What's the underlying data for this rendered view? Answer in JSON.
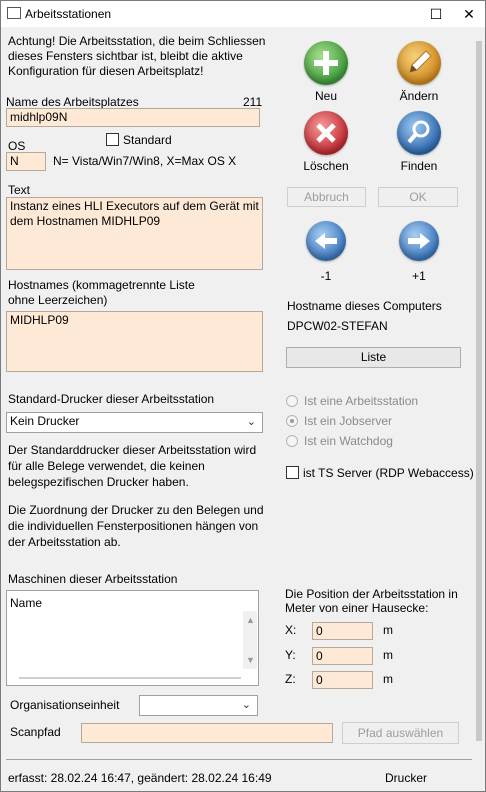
{
  "window": {
    "title": "Arbeitsstationen",
    "minimize_glyph": "—",
    "maximize_glyph": "☐",
    "close_glyph": "✕"
  },
  "warning": "Achtung! Die Arbeitsstation, die beim Schliessen dieses Fensters sichtbar ist, bleibt die aktive Konfiguration für diesen Arbeitsplatz!",
  "workstation": {
    "name_label": "Name des Arbeitsplatzes",
    "id": "211",
    "name_value": "midhlp09N",
    "standard_label": "Standard",
    "os_label": "OS",
    "os_value": "N",
    "os_hint": "N= Vista/Win7/Win8, X=Max OS X",
    "text_label": "Text",
    "text_value": "Instanz eines HLI Executors auf dem Gerät mit dem Hostnamen MIDHLP09",
    "hostnames_label_1": "Hostnames (kommagetrennte Liste",
    "hostnames_label_2": "ohne Leerzeichen)",
    "hostnames_value": "MIDHLP09",
    "printer_label": "Standard-Drucker dieser Arbeitsstation",
    "printer_value": "Kein Drucker",
    "printer_info_1": "Der Standarddrucker dieser Arbeitsstation wird für alle Belege verwendet, die keinen belegspezifischen Drucker haben.",
    "printer_info_2": "Die Zuordnung der Drucker zu den Belegen und die individuellen Fensterpositionen hängen von der Arbeitsstation ab.",
    "machines_label": "Maschinen dieser Arbeitsstation",
    "machines_column": "Name",
    "org_label": "Organisationseinheit",
    "org_value": "",
    "scan_label": "Scanpfad",
    "scan_value": "",
    "scan_button": "Pfad auswählen"
  },
  "actions": {
    "new": "Neu",
    "edit": "Ändern",
    "delete": "Löschen",
    "find": "Finden",
    "cancel": "Abbruch",
    "ok": "OK",
    "prev": "-1",
    "next": "+1"
  },
  "computer": {
    "label": "Hostname dieses Computers",
    "value": "DPCW02-STEFAN",
    "list_button": "Liste"
  },
  "role": {
    "options": [
      "Ist eine Arbeitsstation",
      "Ist ein Jobserver",
      "Ist ein Watchdog"
    ],
    "selected_index": 1,
    "ts_label": "ist TS Server (RDP Webaccess)"
  },
  "position": {
    "label_1": "Die Position der Arbeitsstation in",
    "label_2": "Meter von einer Hausecke:",
    "x_label": "X:",
    "x_value": "0",
    "y_label": "Y:",
    "y_value": "0",
    "z_label": "Z:",
    "z_value": "0",
    "unit": "m"
  },
  "status": {
    "text": "erfasst: 28.02.24 16:47, geändert: 28.02.24 16:49",
    "printer": "Drucker"
  },
  "colors": {
    "field_bg": "#fde9d6",
    "green": "#4caf50",
    "red": "#d9363e",
    "blue": "#2f6fb5",
    "orange": "#e39b2f"
  }
}
